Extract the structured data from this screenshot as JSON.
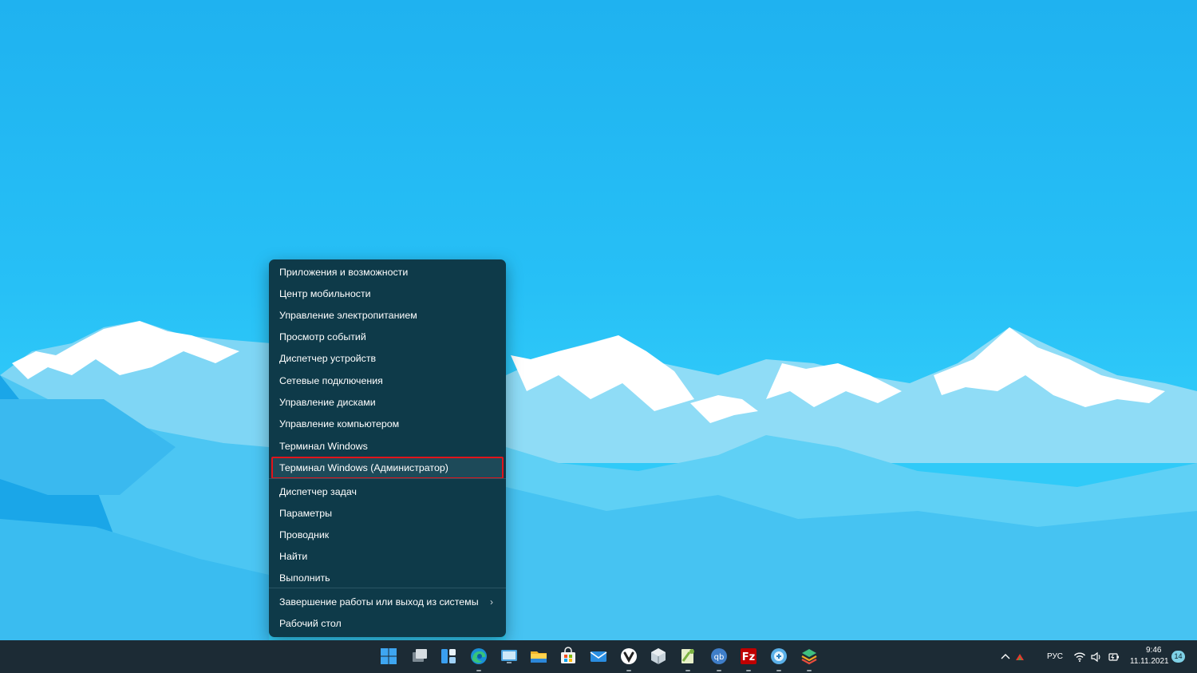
{
  "context_menu": {
    "items": [
      {
        "label": "Приложения и возможности"
      },
      {
        "label": "Центр мобильности"
      },
      {
        "label": "Управление электропитанием"
      },
      {
        "label": "Просмотр событий"
      },
      {
        "label": "Диспетчер устройств"
      },
      {
        "label": "Сетевые подключения"
      },
      {
        "label": "Управление дисками"
      },
      {
        "label": "Управление компьютером"
      },
      {
        "label": "Терминал Windows"
      },
      {
        "label": "Терминал Windows (Администратор)",
        "highlighted": true
      },
      {
        "label": "Диспетчер задач"
      },
      {
        "label": "Параметры"
      },
      {
        "label": "Проводник"
      },
      {
        "label": "Найти"
      },
      {
        "label": "Выполнить"
      },
      {
        "label": "Завершение работы или выход из системы",
        "has_submenu": true
      },
      {
        "label": "Рабочий стол"
      }
    ],
    "highlight_color": "#e0141b"
  },
  "taskbar": {
    "apps": [
      {
        "name": "start-icon"
      },
      {
        "name": "task-view-icon"
      },
      {
        "name": "widgets-icon"
      },
      {
        "name": "edge-icon",
        "running": true
      },
      {
        "name": "remote-desktop-icon"
      },
      {
        "name": "file-explorer-icon"
      },
      {
        "name": "microsoft-store-icon"
      },
      {
        "name": "mail-icon"
      },
      {
        "name": "vivaldi-icon",
        "running": true
      },
      {
        "name": "virtualbox-icon"
      },
      {
        "name": "notepad-plus-plus-icon",
        "running": true
      },
      {
        "name": "qbittorrent-icon",
        "running": true
      },
      {
        "name": "filezilla-icon",
        "running": true
      },
      {
        "name": "network-tool-icon",
        "running": true
      },
      {
        "name": "layers-app-icon",
        "running": true
      }
    ],
    "tray": {
      "language": "РУС",
      "time": "9:46",
      "date": "11.11.2021",
      "notification_count": "14"
    }
  }
}
